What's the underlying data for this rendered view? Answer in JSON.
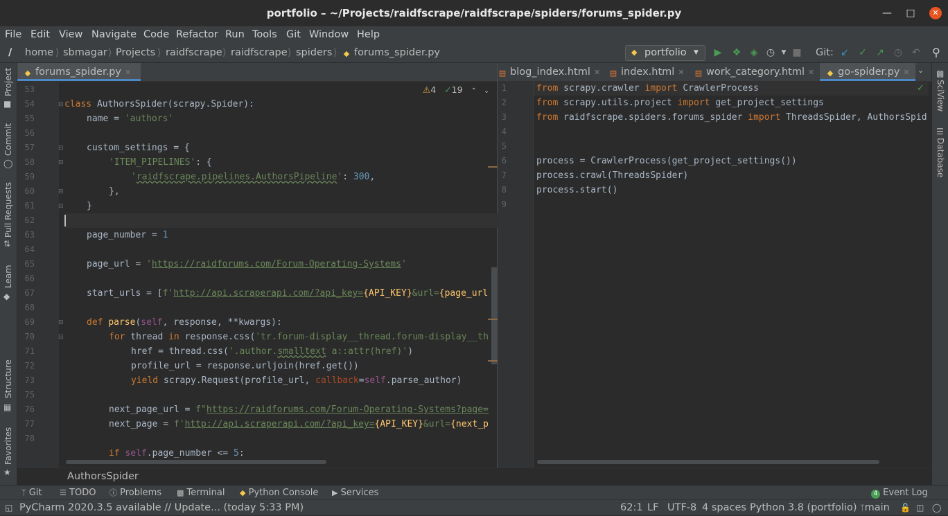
{
  "window": {
    "title": "portfolio – ~/Projects/raidfscrape/raidfscrape/spiders/forums_spider.py"
  },
  "menu": [
    "File",
    "Edit",
    "View",
    "Navigate",
    "Code",
    "Refactor",
    "Run",
    "Tools",
    "Git",
    "Window",
    "Help"
  ],
  "breadcrumbs": {
    "root": "/",
    "items": [
      "home",
      "sbmagar",
      "Projects",
      "raidfscrape",
      "raidfscrape",
      "spiders"
    ],
    "file": "forums_spider.py"
  },
  "run_config": "portfolio",
  "git_label": "Git:",
  "left_tools": [
    "Project",
    "Commit",
    "Pull Requests",
    "Learn",
    "Structure",
    "Favorites"
  ],
  "right_tools": [
    "SciView",
    "Database"
  ],
  "left_editor": {
    "tab": "forums_spider.py",
    "inspections": {
      "warnings": "4",
      "typos": "19"
    },
    "lines": [
      {
        "n": "53"
      },
      {
        "n": "54"
      },
      {
        "n": "55"
      },
      {
        "n": "56"
      },
      {
        "n": "57"
      },
      {
        "n": "58"
      },
      {
        "n": "59"
      },
      {
        "n": "60"
      },
      {
        "n": "61"
      },
      {
        "n": "62"
      },
      {
        "n": "63"
      },
      {
        "n": "64"
      },
      {
        "n": "65"
      },
      {
        "n": "66"
      },
      {
        "n": "67"
      },
      {
        "n": "68"
      },
      {
        "n": "69"
      },
      {
        "n": "70"
      },
      {
        "n": "71"
      },
      {
        "n": "72"
      },
      {
        "n": "73"
      },
      {
        "n": "75"
      },
      {
        "n": "76"
      },
      {
        "n": "77"
      },
      {
        "n": "78"
      }
    ],
    "code": {
      "l54_kw": "class ",
      "l54_rest": "AuthorsSpider(scrapy.Spider):",
      "l55_a": "name = ",
      "l55_s": "'authors'",
      "l57": "custom_settings = {",
      "l58_s": "'ITEM_PIPELINES'",
      "l58_r": ": {",
      "l59_s1": "'",
      "l59_s2": "raidfscrape.pipelines.AuthorsPipeline",
      "l59_s3": "'",
      "l59_r": ": ",
      "l59_n": "300",
      "l59_c": ",",
      "l60": "},",
      "l61": "}",
      "l63_a": "page_number = ",
      "l63_n": "1",
      "l65_a": "page_url = ",
      "l65_q1": "'",
      "l65_u": "https://raidforums.com/Forum-Operating-Systems",
      "l65_q2": "'",
      "l67_a": "start_urls = [",
      "l67_f": "f'",
      "l67_u": "http://api.scraperapi.com/?api_key=",
      "l67_b": "{API_KEY}",
      "l67_s": "&url=",
      "l67_b2": "{page_url",
      "l69_kw": "def ",
      "l69_fn": "parse",
      "l69_p": "(",
      "l69_self": "self",
      "l69_r": ", response, **kwargs):",
      "l70_kw": "for ",
      "l70_a": "thread ",
      "l70_in": "in ",
      "l70_r": "response.css(",
      "l70_s": "'tr.forum-display__thread.forum-display__th",
      "l71_a": "href = thread.css(",
      "l71_s": "'.author.",
      "l71_w": "smalltext",
      "l71_s2": " a::attr(href)'",
      "l71_e": ")",
      "l72": "profile_url = response.urljoin(href.get())",
      "l73_kw": "yield ",
      "l73_a": "scrapy.Request(profile_url, ",
      "l73_p": "callback",
      "l73_eq": "=",
      "l73_self": "self",
      "l73_r": ".parse_author)",
      "l75_a": "next_page_url = ",
      "l75_f": "f\"",
      "l75_u": "https://raidforums.com/Forum-Operating-Systems?page=",
      "l76_a": "next_page = ",
      "l76_f": "f'",
      "l76_u": "http://api.scraperapi.com/?api_key=",
      "l76_b": "{API_KEY}",
      "l76_s": "&url=",
      "l76_b2": "{next_p",
      "l78_kw": "if ",
      "l78_self": "self",
      "l78_r": ".page_number <= ",
      "l78_n": "5",
      "l78_c": ":"
    }
  },
  "right_editor": {
    "tabs": [
      "blog_index.html",
      "index.html",
      "work_category.html",
      "go-spider.py"
    ],
    "lines": [
      "1",
      "2",
      "3",
      "4",
      "5",
      "6",
      "7",
      "8",
      "9"
    ],
    "code": {
      "l1_kw": "from ",
      "l1_a": "scrapy.crawler ",
      "l1_kw2": "import ",
      "l1_b": "CrawlerProcess",
      "l2_kw": "from ",
      "l2_a": "scrapy.utils.project ",
      "l2_kw2": "import ",
      "l2_b": "get_project_settings",
      "l3_kw": "from ",
      "l3_a": "raidfscrape.spiders.forums_spider ",
      "l3_kw2": "import ",
      "l3_b": "ThreadsSpider, AuthorsSpid",
      "l6": "process = CrawlerProcess(get_project_settings())",
      "l7": "process.crawl(ThreadsSpider)",
      "l8": "process.start()"
    }
  },
  "structure_breadcrumb": "AuthorsSpider",
  "toolwindows": [
    "Git",
    "TODO",
    "Problems",
    "Terminal",
    "Python Console",
    "Services"
  ],
  "event_log": {
    "count": "4",
    "label": "Event Log"
  },
  "status": {
    "message": "PyCharm 2020.3.5 available // Update... (today 5:33 PM)",
    "position": "62:1",
    "line_sep": "LF",
    "encoding": "UTF-8",
    "indent": "4 spaces",
    "interpreter": "Python 3.8 (portfolio)",
    "branch": "main"
  },
  "colors": {
    "accent": "#4a88c7",
    "close_button": "#e95420",
    "run_green": "#499c54"
  }
}
